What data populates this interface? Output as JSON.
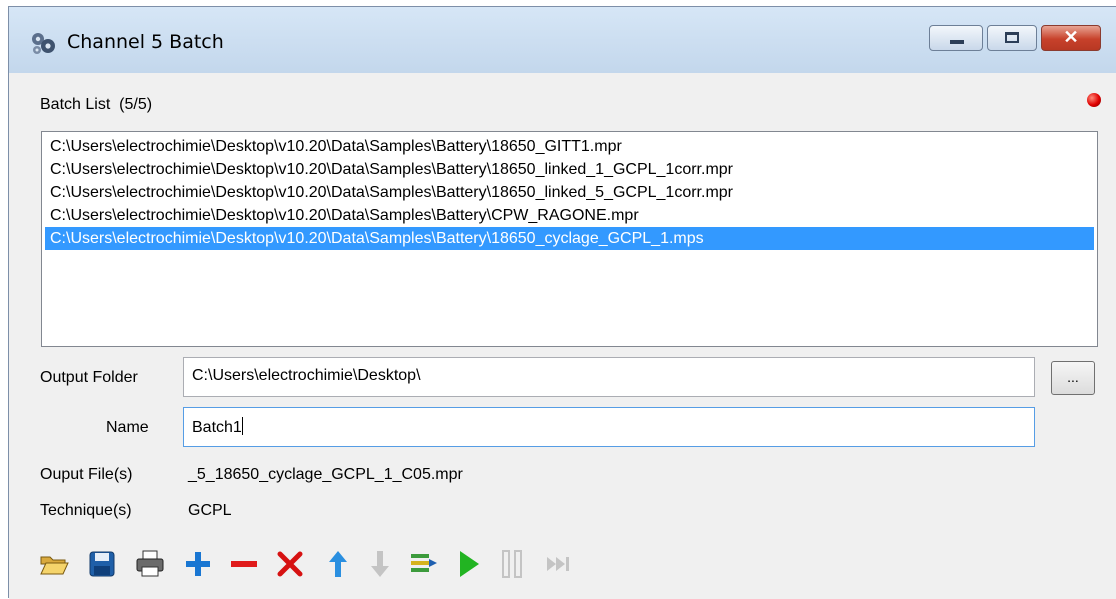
{
  "window": {
    "title": "Channel 5 Batch"
  },
  "title_buttons": {
    "minimize": "minimize-icon",
    "maximize": "maximize-icon",
    "close": "✕"
  },
  "batch_list": {
    "label": "Batch List",
    "count": "(5/5)",
    "status_color": "#e00000",
    "items": [
      "C:\\Users\\electrochimie\\Desktop\\v10.20\\Data\\Samples\\Battery\\18650_GITT1.mpr",
      "C:\\Users\\electrochimie\\Desktop\\v10.20\\Data\\Samples\\Battery\\18650_linked_1_GCPL_1corr.mpr",
      "C:\\Users\\electrochimie\\Desktop\\v10.20\\Data\\Samples\\Battery\\18650_linked_5_GCPL_1corr.mpr",
      "C:\\Users\\electrochimie\\Desktop\\v10.20\\Data\\Samples\\Battery\\CPW_RAGONE.mpr",
      "C:\\Users\\electrochimie\\Desktop\\v10.20\\Data\\Samples\\Battery\\18650_cyclage_GCPL_1.mps"
    ],
    "selected_index": 4,
    "selection_color": "#3399ff"
  },
  "output_folder": {
    "label": "Output Folder",
    "value": "C:\\Users\\electrochimie\\Desktop\\",
    "browse_label": "..."
  },
  "name": {
    "label": "Name",
    "value": "Batch1"
  },
  "output_files": {
    "label": "Ouput File(s)",
    "value": "_5_18650_cyclage_GCPL_1_C05.mpr"
  },
  "technique": {
    "label": "Technique(s)",
    "value": "GCPL"
  },
  "toolbar": {
    "icons": [
      "open-folder-icon",
      "save-disk-icon",
      "print-icon",
      "add-plus-icon",
      "remove-minus-icon",
      "delete-x-icon",
      "move-up-arrow-icon",
      "move-down-arrow-icon",
      "insert-list-icon",
      "run-play-icon",
      "pause-icon",
      "skip-next-icon"
    ],
    "disabled": [
      "move-down-arrow-icon",
      "pause-icon",
      "skip-next-icon"
    ]
  }
}
